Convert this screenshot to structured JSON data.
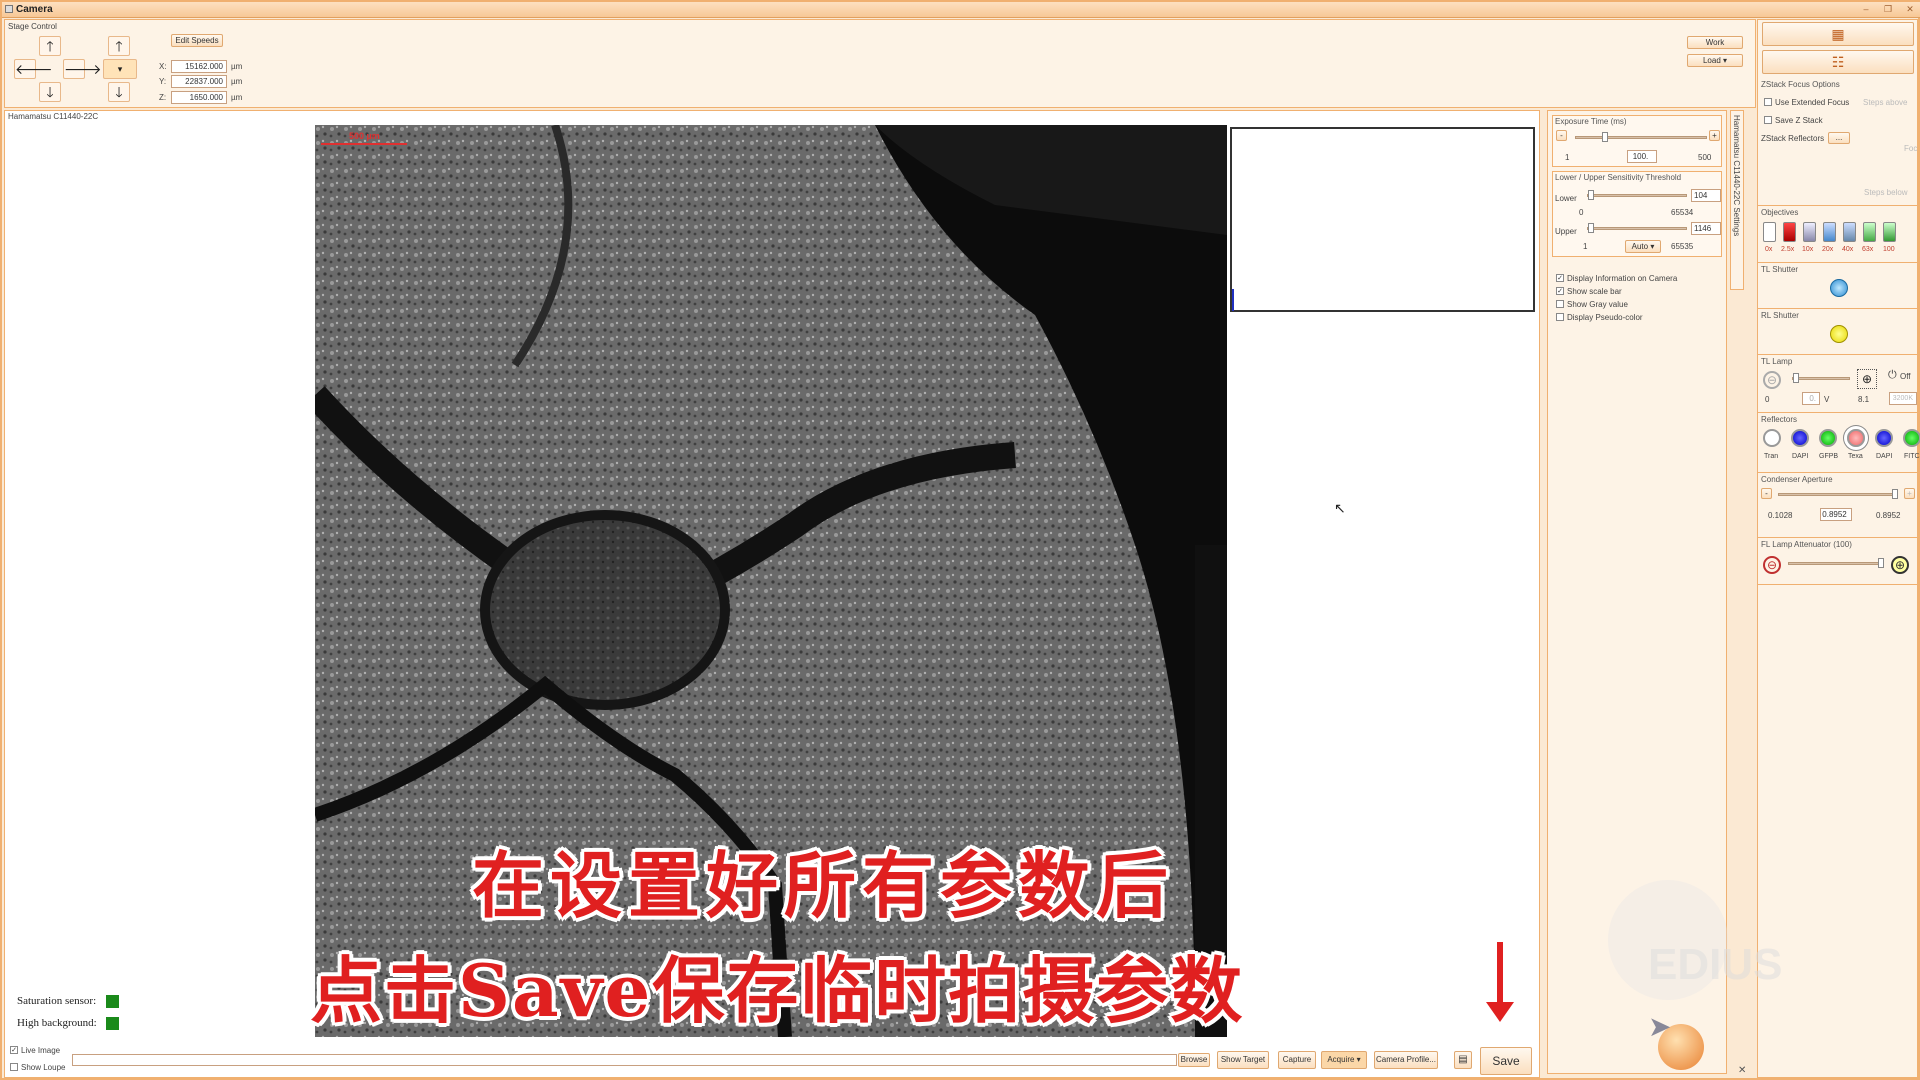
{
  "window": {
    "title": "Camera"
  },
  "stage": {
    "title": "Stage Control",
    "edit_speeds": "Edit Speeds",
    "x_label": "X:",
    "y_label": "Y:",
    "z_label": "Z:",
    "x": "15162.000",
    "y": "22837.000",
    "z": "1650.000",
    "unit": "µm",
    "work": "Work",
    "load": "Load"
  },
  "camera": {
    "name": "Hamamatsu C11440-22C",
    "scale_bar": "500 µm",
    "settings_tab": "Hamamatsu C11440-22C Settings"
  },
  "status": {
    "saturation": "Saturation sensor:",
    "background": "High background:"
  },
  "options": {
    "live_image": "Live Image",
    "show_loupe": "Show Loupe"
  },
  "toolbar": {
    "browse": "Browse",
    "show_target": "Show Target",
    "capture": "Capture",
    "acquire": "Acquire",
    "camera_profile": "Camera Profile...",
    "save": "Save"
  },
  "exposure": {
    "title": "Exposure Time (ms)",
    "minus": "-",
    "plus": "+",
    "min": "1",
    "value": "100.",
    "max": "500"
  },
  "sensitivity": {
    "title": "Lower / Upper Sensitivity Threshold",
    "lower_label": "Lower",
    "lower_value": "104",
    "lower_min": "0",
    "lower_max": "65534",
    "upper_label": "Upper",
    "upper_value": "1146",
    "upper_min": "1",
    "upper_max": "65535",
    "mode": "Auto"
  },
  "display": {
    "info": "Display Information on Camera",
    "scale": "Show scale bar",
    "gray": "Show Gray value",
    "pseudo": "Display Pseudo-color"
  },
  "zstack": {
    "title": "ZStack Focus Options",
    "extended": "Use Extended Focus",
    "save": "Save Z Stack",
    "reflectors": "ZStack Reflectors",
    "dots": "...",
    "steps_above": "Steps above",
    "steps_below": "Steps below",
    "foc": "Foc"
  },
  "objectives": {
    "title": "Objectives",
    "items": [
      "0x",
      "2.5x",
      "10x",
      "20x",
      "40x",
      "63x",
      "100"
    ]
  },
  "shutters": {
    "tl": "TL Shutter",
    "rl": "RL Shutter"
  },
  "tl_lamp": {
    "title": "TL Lamp",
    "min": "0",
    "value": "0.",
    "unit": "V",
    "max": "8.1",
    "off": "Off",
    "temp": "3200K"
  },
  "reflectors": {
    "title": "Reflectors",
    "items": [
      "Tran",
      "DAPI",
      "GFPB",
      "Texa",
      "DAPI",
      "FITC"
    ]
  },
  "condenser": {
    "title": "Condenser Aperture",
    "minus": "-",
    "plus": "+",
    "min": "0.1028",
    "value": "0.8952",
    "max": "0.8952"
  },
  "fl_lamp": {
    "title": "FL Lamp Attenuator (100)"
  },
  "subtitle": {
    "line1": "在设置好所有参数后",
    "line2": "点击Save保存临时拍摄参数"
  },
  "watermark": {
    "text": "EDIUS"
  },
  "colors": {
    "accent": "#f0b070",
    "panel": "#fdf3e6",
    "status_ok": "#1a8a1a",
    "subtitle": "#e02020"
  }
}
